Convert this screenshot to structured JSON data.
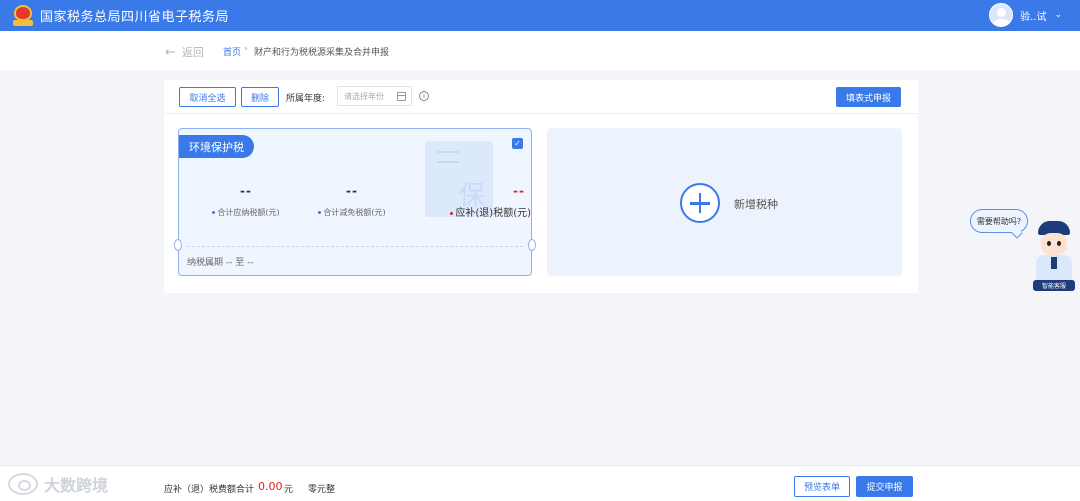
{
  "header": {
    "site_title": "国家税务总局四川省电子税务局",
    "user_name": "验..试",
    "user_menu_icon": "chevron-down-icon",
    "logo_icon": "tax-emblem-icon"
  },
  "breadcrumb": {
    "back_label": "返回",
    "home": "首页",
    "separator": "›",
    "current": "财产和行为税税源采集及合并申报"
  },
  "toolbar": {
    "cancel_select_all": "取消全选",
    "delete": "删除",
    "year_label": "所属年度:",
    "year_placeholder": "请选择年份",
    "info_icon": "info-icon",
    "fill_form_report": "填表式申报"
  },
  "tax_card": {
    "name": "环境保护税",
    "checked": true,
    "watermark_char": "保",
    "stats": [
      {
        "value": "--",
        "label": "合计应纳税额(元)"
      },
      {
        "value": "--",
        "label": "合计减免税额(元)"
      },
      {
        "value": "--",
        "label": "应补(退)税额(元)"
      }
    ],
    "period_label": "纳税属期",
    "period_value": "-- 至 --"
  },
  "add_card": {
    "label": "新增税种"
  },
  "assistant": {
    "bubble_text": "需要帮助吗?",
    "sign_text": "智能客服"
  },
  "footer": {
    "brand": "大数跨境",
    "sum_label": "应补（退）税费额合计",
    "sum_value": "0.00",
    "sum_unit": "元",
    "sum_chinese": "零元整",
    "preview_button": "预览表单",
    "submit_button": "提交申报"
  },
  "colors": {
    "primary": "#3a7ae8",
    "danger": "#e02020",
    "card_bg": "#f0f6ff"
  }
}
